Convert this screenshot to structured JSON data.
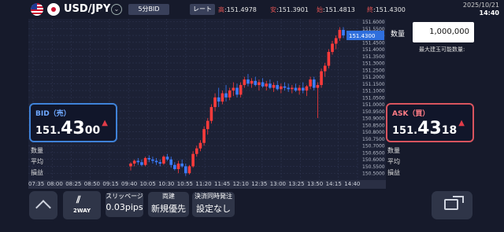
{
  "header": {
    "pair": "USD/JPY",
    "period_button": "5分BID",
    "rate_button": "レート",
    "high_label": "高",
    "high_value": ":151.4978",
    "low_label": "安",
    "low_value": ":151.3901",
    "open_label": "始",
    "open_value": ":151.4813",
    "close_label": "終",
    "close_value": ":151.4300",
    "date": "2025/10/21",
    "time": "14:40"
  },
  "order": {
    "quantity_label": "数量",
    "quantity_value": "1,000,000",
    "max_label": "最大建玉可能数量:"
  },
  "bid": {
    "title": "BID（売）",
    "price_a": "151.",
    "price_b": "43",
    "price_c": "00"
  },
  "ask": {
    "title": "ASK（買）",
    "price_a": "151.",
    "price_b": "43",
    "price_c": "18"
  },
  "left_stats": [
    "数量",
    "平均",
    "損益"
  ],
  "right_stats": [
    "数量",
    "平均",
    "損益"
  ],
  "bottom": {
    "twoway_label": "2WAY",
    "slippage_label": "スリッページ",
    "slippage_value": "0.03pips",
    "link_label": "両建",
    "link_value": "新規優先",
    "settle_label": "決済同時発注",
    "settle_value": "設定なし"
  },
  "chart_data": {
    "type": "candlestick",
    "current_price_label": "151.4300",
    "y_ticks": [
      "151.6000",
      "151.5500",
      "151.5000",
      "151.4500",
      "151.4000",
      "151.3500",
      "151.3000",
      "151.2500",
      "151.2000",
      "151.1500",
      "151.1000",
      "151.0500",
      "151.0000",
      "150.9500",
      "150.9000",
      "150.8500",
      "150.8000",
      "150.7500",
      "150.7000",
      "150.6500",
      "150.6000",
      "150.5500",
      "150.5000"
    ],
    "x_ticks": [
      "07:35",
      "08:00",
      "08:25",
      "08:50",
      "09:15",
      "09:40",
      "10:05",
      "10:30",
      "10:55",
      "11:20",
      "11:45",
      "12:10",
      "12:35",
      "13:00",
      "13:25",
      "13:50",
      "14:15",
      "14:40"
    ],
    "ylim": [
      150.45,
      151.62
    ],
    "up_color": "#ff3b3b",
    "down_color": "#3b7cff",
    "candles": [
      [
        150.55,
        150.58,
        150.52,
        150.57
      ],
      [
        150.57,
        150.6,
        150.55,
        150.59
      ],
      [
        150.59,
        150.61,
        150.56,
        150.58
      ],
      [
        150.58,
        150.6,
        150.55,
        150.56
      ],
      [
        150.56,
        150.62,
        150.55,
        150.61
      ],
      [
        150.61,
        150.63,
        150.58,
        150.6
      ],
      [
        150.6,
        150.62,
        150.57,
        150.59
      ],
      [
        150.59,
        150.61,
        150.56,
        150.58
      ],
      [
        150.58,
        150.6,
        150.55,
        150.57
      ],
      [
        150.57,
        150.63,
        150.56,
        150.62
      ],
      [
        150.62,
        150.64,
        150.59,
        150.6
      ],
      [
        150.6,
        150.62,
        150.54,
        150.56
      ],
      [
        150.56,
        150.58,
        150.52,
        150.53
      ],
      [
        150.53,
        150.59,
        150.5,
        150.57
      ],
      [
        150.57,
        150.6,
        150.54,
        150.55
      ],
      [
        150.55,
        150.57,
        150.48,
        150.5
      ],
      [
        150.5,
        150.56,
        150.49,
        150.55
      ],
      [
        150.55,
        150.66,
        150.54,
        150.64
      ],
      [
        150.64,
        150.7,
        150.62,
        150.68
      ],
      [
        150.68,
        150.74,
        150.66,
        150.72
      ],
      [
        150.72,
        150.84,
        150.7,
        150.82
      ],
      [
        150.82,
        150.9,
        150.78,
        150.88
      ],
      [
        150.88,
        151.0,
        150.86,
        150.98
      ],
      [
        150.98,
        151.08,
        150.95,
        151.05
      ],
      [
        151.05,
        151.12,
        150.98,
        151.02
      ],
      [
        151.02,
        151.1,
        151.0,
        151.08
      ],
      [
        151.08,
        151.14,
        151.02,
        151.05
      ],
      [
        151.05,
        151.12,
        151.03,
        151.1
      ],
      [
        151.1,
        151.16,
        151.06,
        151.12
      ],
      [
        151.12,
        151.15,
        151.05,
        151.07
      ],
      [
        151.07,
        151.16,
        151.05,
        151.14
      ],
      [
        151.14,
        151.2,
        151.12,
        151.18
      ],
      [
        151.18,
        151.22,
        151.13,
        151.15
      ],
      [
        151.15,
        151.19,
        151.12,
        151.17
      ],
      [
        151.17,
        151.2,
        151.13,
        151.14
      ],
      [
        151.14,
        151.18,
        151.1,
        151.16
      ],
      [
        151.16,
        151.19,
        151.12,
        151.13
      ],
      [
        151.13,
        151.17,
        151.1,
        151.15
      ],
      [
        151.15,
        151.18,
        151.11,
        151.12
      ],
      [
        151.12,
        151.16,
        151.09,
        151.14
      ],
      [
        151.14,
        151.17,
        151.1,
        151.11
      ],
      [
        151.11,
        151.15,
        151.08,
        151.13
      ],
      [
        151.13,
        151.16,
        151.1,
        151.12
      ],
      [
        151.12,
        151.15,
        151.09,
        151.11
      ],
      [
        151.11,
        151.14,
        151.08,
        151.12
      ],
      [
        151.12,
        151.15,
        151.09,
        151.1
      ],
      [
        151.1,
        151.14,
        151.07,
        151.12
      ],
      [
        151.12,
        151.16,
        151.08,
        151.1
      ],
      [
        151.1,
        151.14,
        151.06,
        151.13
      ],
      [
        151.13,
        151.2,
        151.11,
        151.18
      ],
      [
        151.18,
        151.2,
        151.1,
        151.12
      ],
      [
        151.12,
        151.16,
        150.9,
        151.14
      ],
      [
        151.14,
        151.26,
        151.12,
        151.24
      ],
      [
        151.24,
        151.3,
        151.2,
        151.28
      ],
      [
        151.28,
        151.4,
        151.26,
        151.38
      ],
      [
        151.38,
        151.46,
        151.36,
        151.44
      ],
      [
        151.44,
        151.5,
        151.4,
        151.48
      ],
      [
        151.48,
        151.56,
        151.46,
        151.54
      ],
      [
        151.54,
        151.56,
        151.48,
        151.5
      ]
    ]
  }
}
